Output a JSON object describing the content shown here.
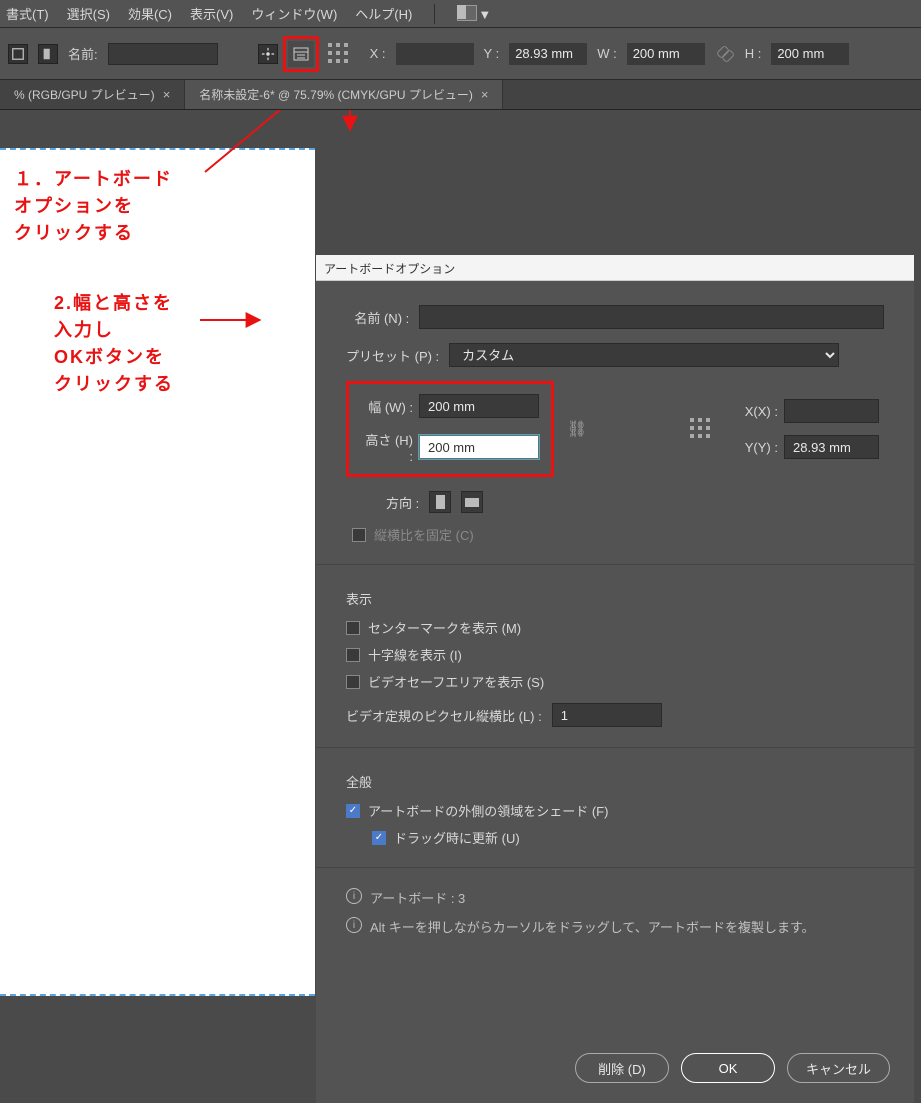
{
  "menu": {
    "items": [
      "書式(T)",
      "選択(S)",
      "効果(C)",
      "表示(V)",
      "ウィンドウ(W)",
      "ヘルプ(H)"
    ]
  },
  "optbar": {
    "name_label": "名前:",
    "name_value": "",
    "x_label": "X :",
    "x_value": "",
    "y_label": "Y :",
    "y_value": "28.93 mm",
    "w_label": "W :",
    "w_value": "200 mm",
    "h_label": "H :",
    "h_value": "200 mm"
  },
  "tabs": {
    "t1": {
      "label": "% (RGB/GPU プレビュー)"
    },
    "t2": {
      "label": "名称未設定-6* @ 75.79% (CMYK/GPU プレビュー)"
    }
  },
  "callouts": {
    "c1": "１．アートボード\nオプションを\nクリックする",
    "c2": "2.幅と高さを\n入力し\nOKボタンを\nクリックする"
  },
  "dialog": {
    "title": "アートボードオプション",
    "name_label": "名前 (N) :",
    "name_value": "",
    "preset_label": "プリセット (P) :",
    "preset_value": "カスタム",
    "w_label": "幅 (W) :",
    "w_value": "200 mm",
    "h_label": "高さ (H) :",
    "h_value": "200 mm",
    "x_label": "X(X) :",
    "x_value": "",
    "y_label": "Y(Y) :",
    "y_value": "28.93 mm",
    "orient_label": "方向 :",
    "lockratio_label": "縦横比を固定 (C)",
    "display_section": "表示",
    "disp_center": "センターマークを表示 (M)",
    "disp_cross": "十字線を表示 (I)",
    "disp_safe": "ビデオセーフエリアを表示 (S)",
    "pixel_ratio_label": "ビデオ定規のピクセル縦横比 (L) :",
    "pixel_ratio_value": "1",
    "general_section": "全般",
    "gen_shade": "アートボードの外側の領域をシェード (F)",
    "gen_drag": "ドラッグ時に更新 (U)",
    "info_count": "アートボード : 3",
    "info_tip": "Alt キーを押しながらカーソルをドラッグして、アートボードを複製します。",
    "btn_delete": "削除 (D)",
    "btn_ok": "OK",
    "btn_cancel": "キャンセル"
  }
}
